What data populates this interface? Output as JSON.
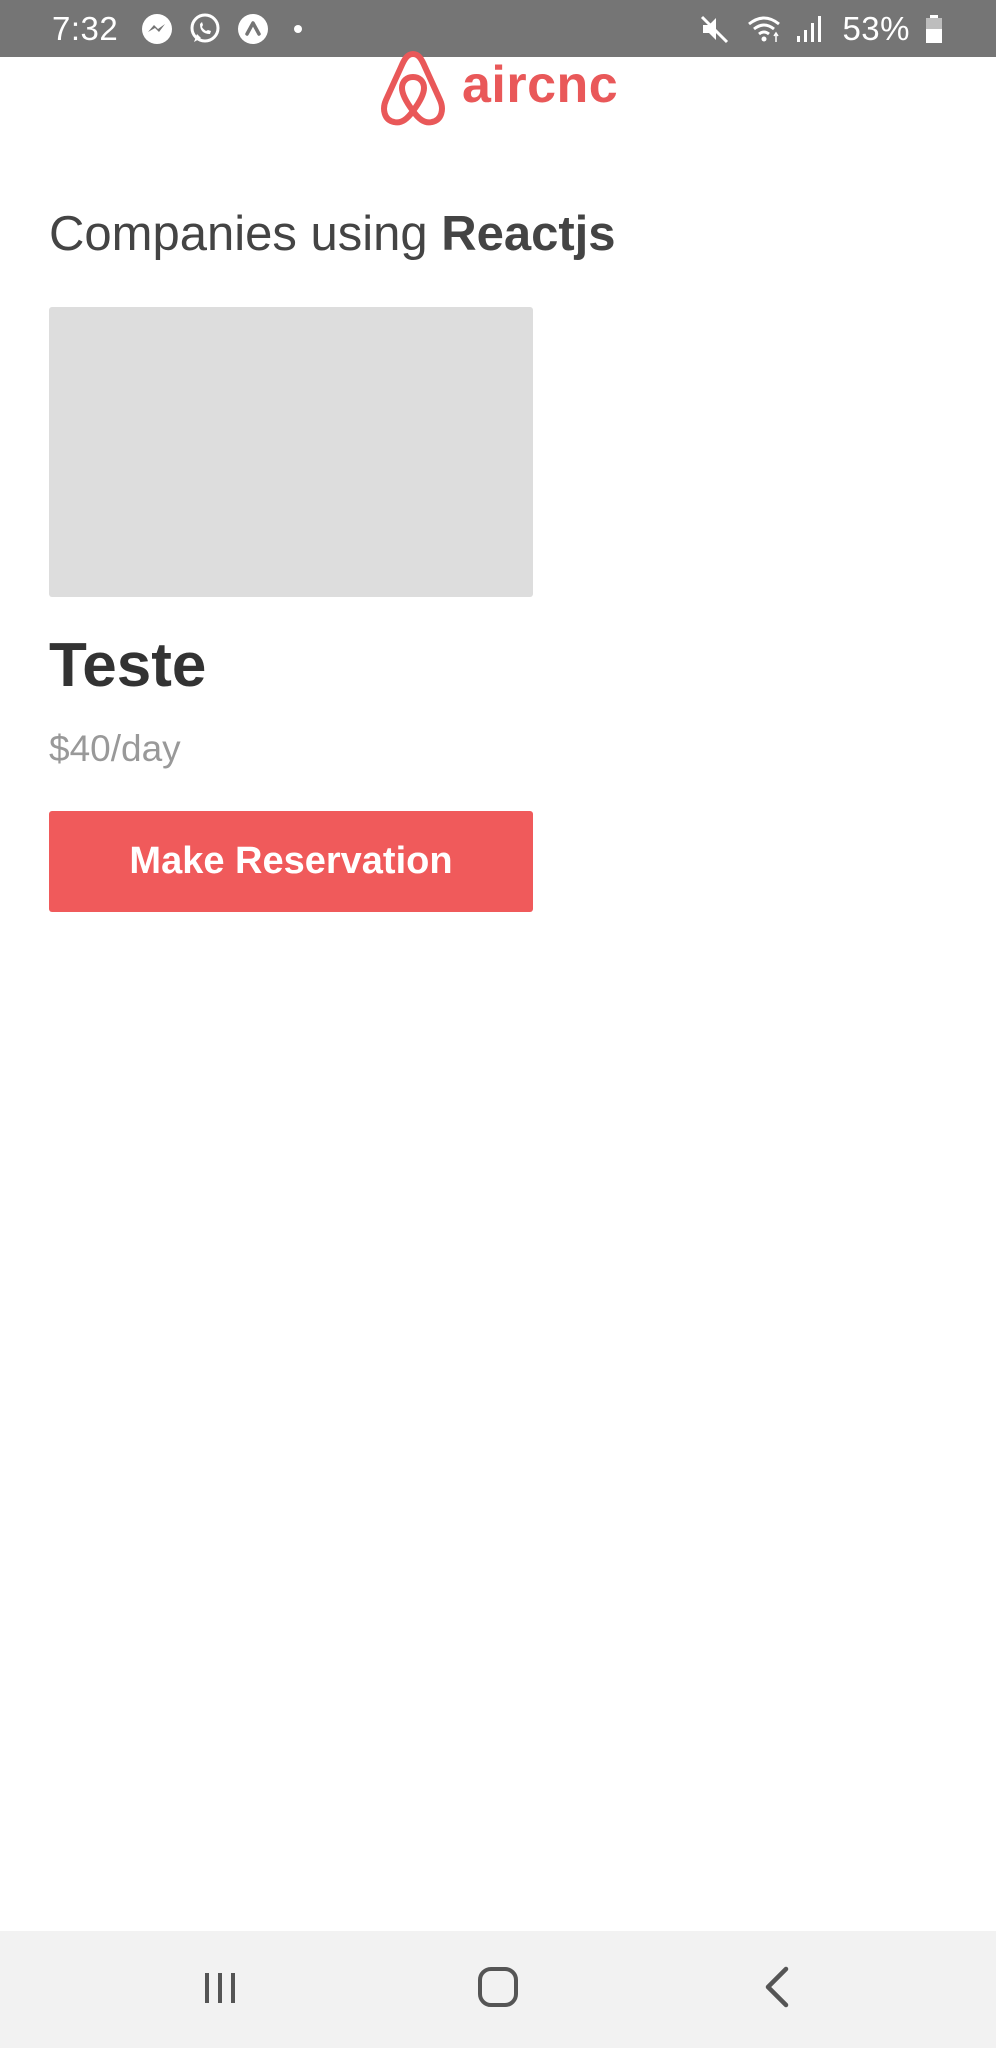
{
  "status_bar": {
    "time": "7:32",
    "notification_icons": [
      "messenger-icon",
      "whatsapp-icon",
      "caret-up-icon"
    ],
    "system_icons": [
      "mute-icon",
      "wifi-icon",
      "signal-icon",
      "battery-icon"
    ],
    "battery_percent": "53%"
  },
  "header": {
    "logo_icon": "airbnb-logo-icon",
    "logo_text": "aircnc",
    "brand_color": "#e95859"
  },
  "main": {
    "heading_prefix": "Companies using ",
    "heading_tech": "Reactjs",
    "spots": [
      {
        "company": "Teste",
        "price": "$40/day",
        "button_label": "Make Reservation"
      }
    ]
  },
  "nav_bar": {
    "buttons": [
      "recent-apps-icon",
      "home-icon",
      "back-icon"
    ]
  },
  "colors": {
    "accent": "#f05a5b",
    "status_bar_bg": "#757575",
    "thumbnail_placeholder": "#dddddd",
    "nav_bar_bg": "#f2f2f2"
  }
}
